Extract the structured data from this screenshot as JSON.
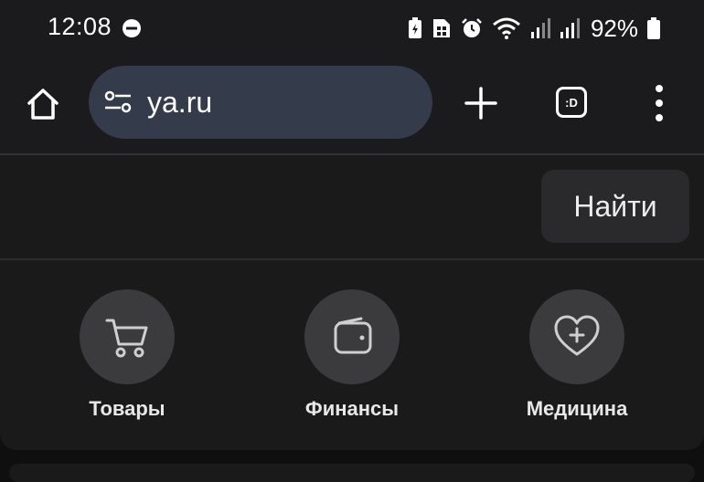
{
  "status_bar": {
    "time": "12:08",
    "battery_percent": "92%",
    "icons": [
      "do-not-disturb-icon",
      "battery-saver-icon",
      "sim-icon",
      "alarm-icon",
      "wifi-icon",
      "signal-icon",
      "signal-icon",
      "battery-icon"
    ]
  },
  "toolbar": {
    "url": "ya.ru",
    "tab_label": ":D"
  },
  "search": {
    "find_label": "Найти"
  },
  "services": [
    {
      "label": "Товары",
      "icon": "cart-icon"
    },
    {
      "label": "Финансы",
      "icon": "wallet-icon"
    },
    {
      "label": "Медицина",
      "icon": "heart-plus-icon"
    }
  ],
  "colors": {
    "background": "#0f0f10",
    "toolbar": "#1b1b1d",
    "url_bar": "#343b4a",
    "service_circle": "#3b3b3d"
  }
}
